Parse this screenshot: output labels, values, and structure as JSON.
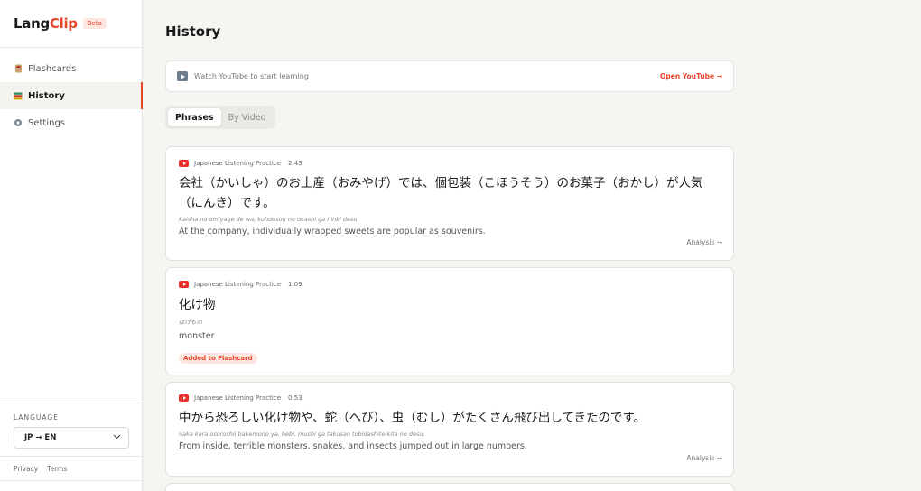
{
  "app": {
    "brand_part1": "Lang",
    "brand_part2": "Clip",
    "badge": "Beta",
    "accent": "#e8462b"
  },
  "sidebar": {
    "items": [
      {
        "label": "Flashcards",
        "icon": "flashcards-icon"
      },
      {
        "label": "History",
        "icon": "books-icon",
        "active": true
      },
      {
        "label": "Settings",
        "icon": "gear-icon"
      }
    ],
    "language_title": "LANGUAGE",
    "language_value": "JP → EN",
    "links": [
      "Privacy",
      "Terms"
    ]
  },
  "main": {
    "title": "History",
    "youtube_prompt": "Watch YouTube to start learning",
    "open_youtube": "Open YouTube →",
    "tabs": [
      {
        "label": "Phrases",
        "active": true
      },
      {
        "label": "By Video"
      }
    ],
    "cards": [
      {
        "source": "Japanese Listening Practice",
        "time": "2:43",
        "phrase_line1": "会社（かいしゃ）のお土産（おみやげ）では、個包装（こほうそう）のお菓子（おかし）が人気",
        "phrase_line2": "（にんき）です。",
        "romaji": "Kaisha no omiyage de wa, kohousou no okashi ga ninki desu.",
        "translation": "At the company, individually wrapped sweets are popular as souvenirs.",
        "action": "Analysis →"
      },
      {
        "source": "Japanese Listening Practice",
        "time": "1:09",
        "phrase_line1": "化け物",
        "romaji": "ばけもの",
        "translation": "monster",
        "badge": "Added to Flashcard"
      },
      {
        "source": "Japanese Listening Practice",
        "time": "0:53",
        "phrase_line1": "中から恐ろしい化け物や、蛇（へび）、虫（むし）がたくさん飛び出してきたのです。",
        "romaji": "naka kara osoroshii bakemono ya, hebi, mushi ga takusan tobidashite kita no desu.",
        "translation": "From inside, terrible monsters, snakes, and insects jumped out in large numbers.",
        "action": "Analysis →"
      }
    ]
  }
}
